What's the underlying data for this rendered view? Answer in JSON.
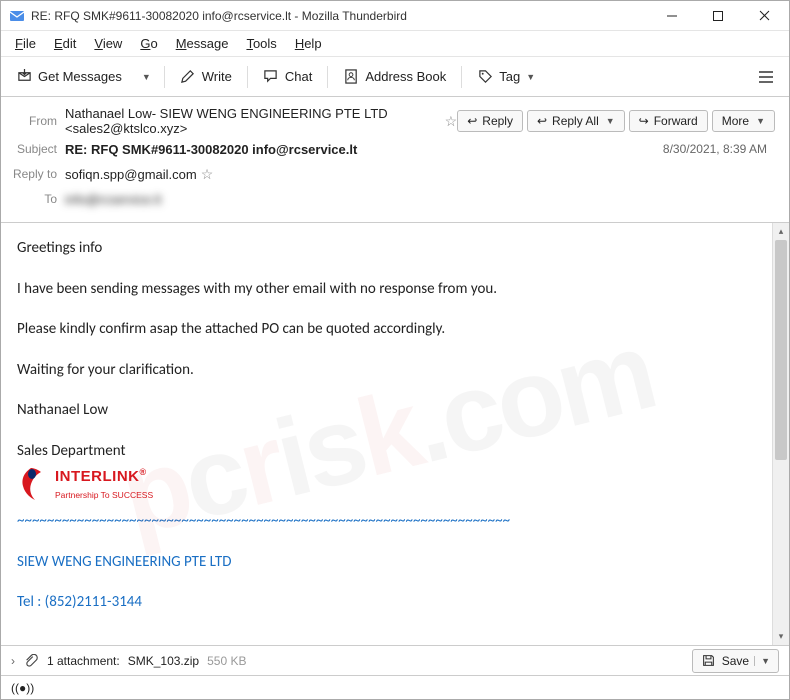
{
  "window": {
    "title": "RE: RFQ SMK#9611-30082020 info@rcservice.lt - Mozilla Thunderbird"
  },
  "menu": {
    "file": "File",
    "edit": "Edit",
    "view": "View",
    "go": "Go",
    "message": "Message",
    "tools": "Tools",
    "help": "Help"
  },
  "toolbar": {
    "get": "Get Messages",
    "write": "Write",
    "chat": "Chat",
    "addr": "Address Book",
    "tag": "Tag"
  },
  "hdr": {
    "from_lab": "From",
    "from": "Nathanael Low- SIEW WENG ENGINEERING PTE LTD <sales2@ktslco.xyz>",
    "subject_lab": "Subject",
    "subject": "RE: RFQ SMK#9611-30082020 info@rcservice.lt",
    "replyto_lab": "Reply to",
    "replyto": "sofiqn.spp@gmail.com",
    "to_lab": "To",
    "to": "info@rcservice.lt",
    "date": "8/30/2021, 8:39 AM",
    "reply": "Reply",
    "replyall": "Reply All",
    "forward": "Forward",
    "more": "More"
  },
  "body": {
    "greet": "Greetings info",
    "p1": "I have been sending messages with my other email with no response from you.",
    "p2": "Please kindly confirm asap the attached PO can be quoted accordingly.",
    "p3": "Waiting for your clarification.",
    "name": "Nathanael Low",
    "dept": "Sales Department",
    "logo_name": "INTERLINK",
    "logo_r": "®",
    "logo_tag": "Partnership To SUCCESS",
    "wave": "~~~~~~~~~~~~~~~~~~~~~~~~~~~~~~~~~~~~~~~~~~~~~~~~~~~~~~~~~~~~~~~~~~",
    "company": "SIEW WENG ENGINEERING PTE LTD",
    "tel": "Tel : (852)2111-3144"
  },
  "att": {
    "label": "1 attachment:",
    "file": "SMK_103.zip",
    "size": "550 KB",
    "save": "Save"
  }
}
